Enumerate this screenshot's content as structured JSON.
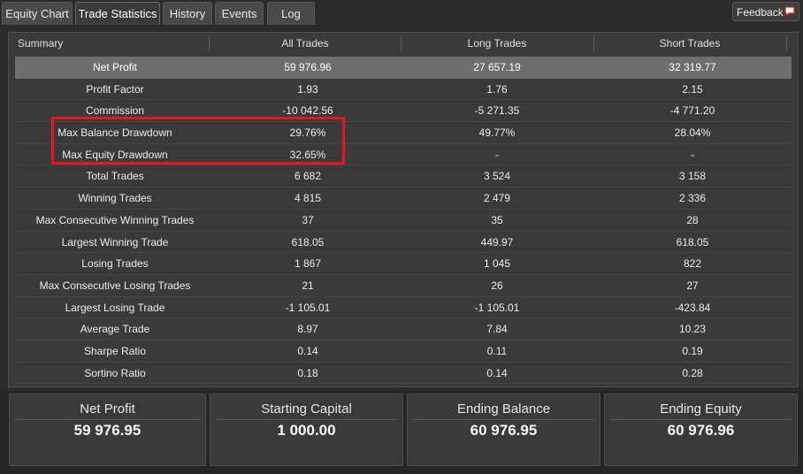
{
  "tabs": [
    {
      "label": "Equity Chart"
    },
    {
      "label": "Trade Statistics"
    },
    {
      "label": "History"
    },
    {
      "label": "Events"
    },
    {
      "label": "Log"
    }
  ],
  "feedback": {
    "label": "Feedback"
  },
  "table": {
    "headers": [
      "Summary",
      "All Trades",
      "Long Trades",
      "Short Trades"
    ],
    "rows": [
      [
        "Net Profit",
        "59 976.96",
        "27 657.19",
        "32 319.77"
      ],
      [
        "Profit Factor",
        "1.93",
        "1.76",
        "2.15"
      ],
      [
        "Commission",
        "-10 042.56",
        "-5 271.35",
        "-4 771.20"
      ],
      [
        "Max Balance Drawdown",
        "29.76%",
        "49.77%",
        "28.04%"
      ],
      [
        "Max Equity Drawdown",
        "32.65%",
        "-",
        "-"
      ],
      [
        "Total Trades",
        "6 682",
        "3 524",
        "3 158"
      ],
      [
        "Winning Trades",
        "4 815",
        "2 479",
        "2 336"
      ],
      [
        "Max Consecutive Winning Trades",
        "37",
        "35",
        "28"
      ],
      [
        "Largest Winning Trade",
        "618.05",
        "449.97",
        "618.05"
      ],
      [
        "Losing Trades",
        "1 867",
        "1 045",
        "822"
      ],
      [
        "Max Consecutive Losing Trades",
        "21",
        "26",
        "27"
      ],
      [
        "Largest Losing Trade",
        "-1 105.01",
        "-1 105.01",
        "-423.84"
      ],
      [
        "Average Trade",
        "8.97",
        "7.84",
        "10.23"
      ],
      [
        "Sharpe Ratio",
        "0.14",
        "0.11",
        "0.19"
      ],
      [
        "Sortino Ratio",
        "0.18",
        "0.14",
        "0.28"
      ]
    ]
  },
  "cards": [
    {
      "title": "Net Profit",
      "value": "59 976.95"
    },
    {
      "title": "Starting Capital",
      "value": "1 000.00"
    },
    {
      "title": "Ending Balance",
      "value": "60 976.95"
    },
    {
      "title": "Ending Equity",
      "value": "60 976.96"
    }
  ],
  "colors": {
    "highlight_box": "#e8141e",
    "selected_row": "#6e6e6e",
    "background": "#2b2b2b"
  }
}
